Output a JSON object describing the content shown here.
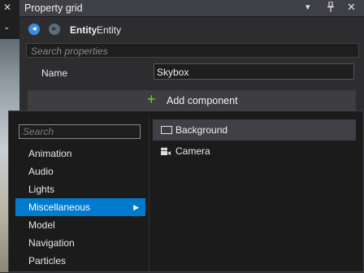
{
  "panel": {
    "title": "Property grid",
    "dropdown_glyph": "▾",
    "pin_glyph": "📌",
    "close_glyph": "✕"
  },
  "viewport": {
    "close_glyph": "✕",
    "chevron_glyph": "⌄"
  },
  "entity": {
    "kind": "Entity",
    "name": "Entity",
    "back_icon": "arrow-left-icon",
    "forward_icon": "arrow-right-icon"
  },
  "search": {
    "placeholder": "Search properties"
  },
  "name_field": {
    "label": "Name",
    "value": "Skybox"
  },
  "add_component": {
    "label": "Add component",
    "icon": "plus-icon",
    "icon_color": "#7ed321"
  },
  "popup": {
    "search_placeholder": "Search",
    "categories": [
      {
        "label": "Animation"
      },
      {
        "label": "Audio"
      },
      {
        "label": "Lights"
      },
      {
        "label": "Miscellaneous",
        "selected": true
      },
      {
        "label": "Model"
      },
      {
        "label": "Navigation"
      },
      {
        "label": "Particles"
      }
    ],
    "components": [
      {
        "label": "Background",
        "icon": "rectangle-icon"
      },
      {
        "label": "Camera",
        "icon": "camera-icon"
      }
    ],
    "selection_color": "#007acc"
  }
}
